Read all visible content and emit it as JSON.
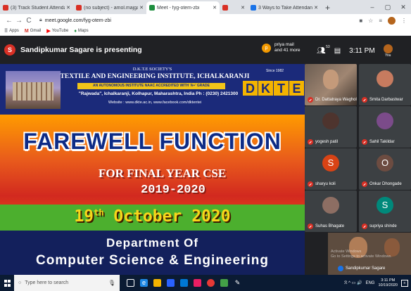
{
  "browser": {
    "tabs": [
      {
        "title": "(3) Track Student Attendance in L",
        "color": "#d93025"
      },
      {
        "title": "(no subject) - amol.majgave@gm",
        "color": "#d93025"
      },
      {
        "title": "Meet - fyg-otem-zbi",
        "color": "#1e8e3e"
      },
      {
        "title": "",
        "color": "#d93025"
      },
      {
        "title": "3 Ways to Take Attendance in Te",
        "color": "#1a73e8"
      }
    ],
    "new_tab": "+",
    "window_controls": [
      "–",
      "▢",
      "✕"
    ],
    "nav": {
      "back": "←",
      "forward": "→",
      "reload": "C"
    },
    "url": "meet.google.com/fyg-otem-zbi",
    "bookmarks": [
      {
        "label": "Apps",
        "icon": "apps-icon",
        "glyph": "⠿",
        "color": "#5f6368"
      },
      {
        "label": "Gmail",
        "icon": "gmail-icon",
        "glyph": "M",
        "color": "#d93025"
      },
      {
        "label": "YouTube",
        "icon": "youtube-icon",
        "glyph": "▶",
        "color": "#ff0000"
      },
      {
        "label": "Maps",
        "icon": "maps-icon",
        "glyph": "♦",
        "color": "#1e8e3e"
      }
    ]
  },
  "meet": {
    "presenter_initial": "S",
    "presenting_text": "Sandipkumar Sagare is presenting",
    "pinned": {
      "initial": "p",
      "line1": "priya mail",
      "line2": "and 41 more"
    },
    "people_count": "53",
    "time": "3:11 PM",
    "you_label": "You"
  },
  "slide": {
    "society": "D.K.T.E SOCIETY'S",
    "institute": "TEXTILE AND ENGINEERING INSTITUTE, ICHALKARANJI",
    "autonomous": "AN AUTONOMOUS INSTITUTE NAAC ACCREDITED WITH 'A+' GRADE",
    "address": "\"Rajwada\", Ichalkaranji, Kolhapur, Maharashtra, India Ph : (0230) 2421300",
    "website": "Website : www.dkte.ac.in, www.facebook.com/dktentei",
    "since": "Since 1982",
    "logo_letters": [
      "D",
      "K",
      "T",
      "E"
    ],
    "farewell": "FAREWELL FUNCTION",
    "for_year": "FOR FINAL YEAR CSE",
    "years": "2019-2020",
    "date_day": "19",
    "date_sup": "th",
    "date_rest": "October 2020",
    "dept_line1": "Department Of",
    "dept_line2": "Computer Science & Engineering"
  },
  "participants": [
    {
      "name": "Dr. Dattatraya Waghole",
      "initial": "",
      "color": "#6b5d52",
      "video": true
    },
    {
      "name": "Smita Darbastwar",
      "initial": "",
      "color": "#3c4043",
      "avatar_color": "#c77b5f",
      "video": false
    },
    {
      "name": "yogesh patil",
      "initial": "",
      "color": "#3c4043",
      "avatar_color": "#4e342e",
      "video": false
    },
    {
      "name": "Sahil Takildar",
      "initial": "",
      "color": "#3c4043",
      "avatar_color": "#7b4b8a",
      "video": false
    },
    {
      "name": "sharyu koli",
      "initial": "S",
      "color": "#3c4043",
      "avatar_color": "#d84315",
      "video": false
    },
    {
      "name": "Onkar Dhongade",
      "initial": "O",
      "color": "#3c4043",
      "avatar_color": "#6d4c41",
      "video": false
    },
    {
      "name": "Suhas Bhagate",
      "initial": "",
      "color": "#3c4043",
      "avatar_color": "#8d6e63",
      "video": false
    },
    {
      "name": "supriya shinde",
      "initial": "S",
      "color": "#3c4043",
      "avatar_color": "#00897b",
      "video": false
    }
  ],
  "self_view": {
    "label": "Sandipkumar Sagare",
    "watermark1": "Activate Windows",
    "watermark2": "Go to Settings to activate Windows."
  },
  "taskbar": {
    "search_placeholder": "Type here to search",
    "tray_lang": "ENG",
    "tray_time": "3:11 PM",
    "tray_date": "10/19/2020",
    "tray_icons": "ℛ ^ ▭ 🔊"
  }
}
